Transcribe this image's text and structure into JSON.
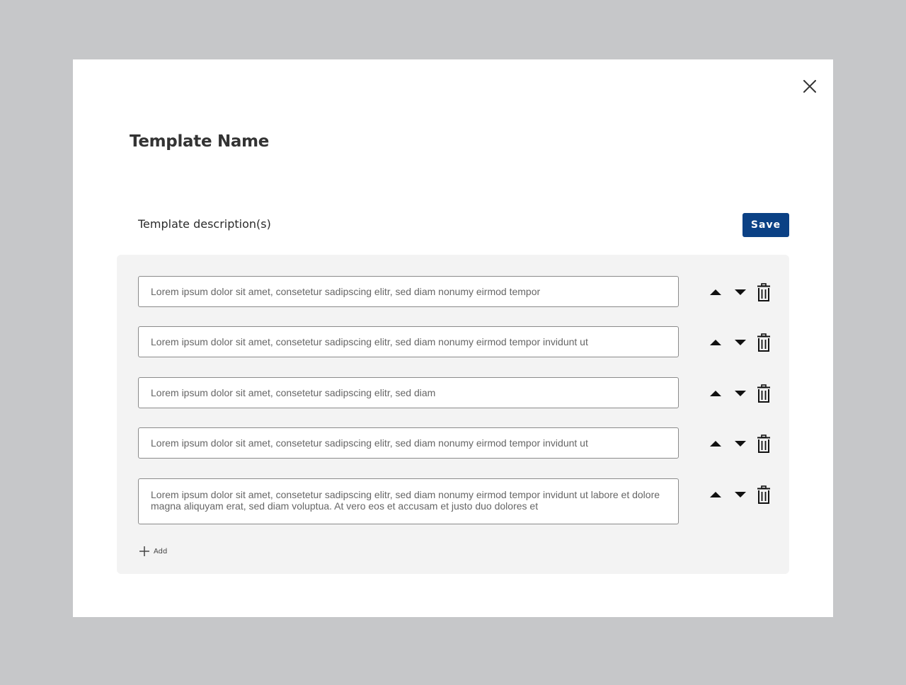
{
  "modal": {
    "title": "Template Name",
    "close_icon": "close-icon"
  },
  "section": {
    "label": "Template description(s)",
    "save_label": "Save"
  },
  "colors": {
    "primary": "#0b4185",
    "backdrop": "#c6c7c9",
    "panel": "#f3f3f3"
  },
  "descriptions": [
    {
      "text": "Lorem ipsum dolor sit amet, consetetur sadipscing elitr, sed diam nonumy eirmod tempor"
    },
    {
      "text": "Lorem ipsum dolor sit amet, consetetur sadipscing elitr, sed diam nonumy eirmod tempor invidunt ut"
    },
    {
      "text": "Lorem ipsum dolor sit amet, consetetur sadipscing elitr, sed diam"
    },
    {
      "text": "Lorem ipsum dolor sit amet, consetetur sadipscing elitr, sed diam nonumy eirmod tempor invidunt ut"
    },
    {
      "text": "Lorem ipsum dolor sit amet, consetetur sadipscing elitr, sed diam nonumy eirmod tempor invidunt ut labore et dolore magna aliquyam erat, sed diam voluptua. At vero eos et accusam et justo duo dolores et"
    }
  ],
  "row_icons": [
    "move-up-icon",
    "move-down-icon",
    "trash-icon"
  ],
  "add": {
    "label": "Add",
    "icon": "plus-icon"
  }
}
